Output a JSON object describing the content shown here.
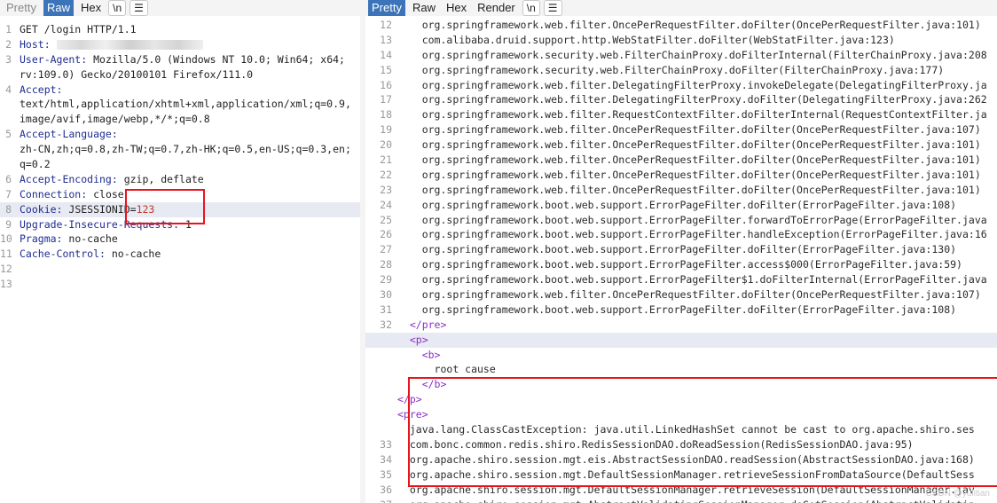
{
  "request_panel": {
    "tabs": [
      {
        "label": "Pretty",
        "state": "inactive"
      },
      {
        "label": "Raw",
        "state": "active"
      },
      {
        "label": "Hex",
        "state": "normal"
      }
    ],
    "newline_button": "\\n",
    "menu_icon": "hamburger-menu-icon",
    "lines": [
      {
        "num": "1",
        "value": "GET /login HTTP/1.1"
      },
      {
        "num": "2",
        "header": "Host:",
        "value": "",
        "blurred": true
      },
      {
        "num": "3",
        "header": "User-Agent:",
        "value": " Mozilla/5.0 (Windows NT 10.0; Win64; x64;"
      },
      {
        "num": "",
        "value": "rv:109.0) Gecko/20100101 Firefox/111.0"
      },
      {
        "num": "4",
        "header": "Accept:",
        "value": ""
      },
      {
        "num": "",
        "value": "text/html,application/xhtml+xml,application/xml;q=0.9,"
      },
      {
        "num": "",
        "value": "image/avif,image/webp,*/*;q=0.8"
      },
      {
        "num": "5",
        "header": "Accept-Language:",
        "value": ""
      },
      {
        "num": "",
        "value": "zh-CN,zh;q=0.8,zh-TW;q=0.7,zh-HK;q=0.5,en-US;q=0.3,en;"
      },
      {
        "num": "",
        "value": "q=0.2"
      },
      {
        "num": "6",
        "header": "Accept-Encoding:",
        "value": " gzip, deflate"
      },
      {
        "num": "7",
        "header": "Connection:",
        "value": " close"
      },
      {
        "num": "8",
        "header": "Cookie:",
        "value": " JSESSIONID=",
        "cookie_value": "123",
        "highlight": true
      },
      {
        "num": "9",
        "header": "Upgrade-Insecure-Requests:",
        "value": " 1"
      },
      {
        "num": "10",
        "header": "Pragma:",
        "value": " no-cache"
      },
      {
        "num": "11",
        "header": "Cache-Control:",
        "value": " no-cache"
      },
      {
        "num": "12",
        "value": ""
      },
      {
        "num": "13",
        "value": ""
      }
    ]
  },
  "response_panel": {
    "tabs": [
      {
        "label": "Pretty",
        "state": "active"
      },
      {
        "label": "Raw",
        "state": "normal"
      },
      {
        "label": "Hex",
        "state": "normal"
      },
      {
        "label": "Render",
        "state": "normal"
      }
    ],
    "newline_button": "\\n",
    "menu_icon": "hamburger-menu-icon",
    "lines": [
      {
        "num": "12",
        "indent": "    ",
        "text": "org.springframework.web.filter.OncePerRequestFilter.doFilter(OncePerRequestFilter.java:101)"
      },
      {
        "num": "13",
        "indent": "    ",
        "text": "com.alibaba.druid.support.http.WebStatFilter.doFilter(WebStatFilter.java:123)"
      },
      {
        "num": "14",
        "indent": "    ",
        "text": "org.springframework.security.web.FilterChainProxy.doFilterInternal(FilterChainProxy.java:208"
      },
      {
        "num": "15",
        "indent": "    ",
        "text": "org.springframework.security.web.FilterChainProxy.doFilter(FilterChainProxy.java:177)"
      },
      {
        "num": "16",
        "indent": "    ",
        "text": "org.springframework.web.filter.DelegatingFilterProxy.invokeDelegate(DelegatingFilterProxy.ja"
      },
      {
        "num": "17",
        "indent": "    ",
        "text": "org.springframework.web.filter.DelegatingFilterProxy.doFilter(DelegatingFilterProxy.java:262"
      },
      {
        "num": "18",
        "indent": "    ",
        "text": "org.springframework.web.filter.RequestContextFilter.doFilterInternal(RequestContextFilter.ja"
      },
      {
        "num": "19",
        "indent": "    ",
        "text": "org.springframework.web.filter.OncePerRequestFilter.doFilter(OncePerRequestFilter.java:107)"
      },
      {
        "num": "20",
        "indent": "    ",
        "text": "org.springframework.web.filter.OncePerRequestFilter.doFilter(OncePerRequestFilter.java:101)"
      },
      {
        "num": "21",
        "indent": "    ",
        "text": "org.springframework.web.filter.OncePerRequestFilter.doFilter(OncePerRequestFilter.java:101)"
      },
      {
        "num": "22",
        "indent": "    ",
        "text": "org.springframework.web.filter.OncePerRequestFilter.doFilter(OncePerRequestFilter.java:101)"
      },
      {
        "num": "23",
        "indent": "    ",
        "text": "org.springframework.web.filter.OncePerRequestFilter.doFilter(OncePerRequestFilter.java:101)"
      },
      {
        "num": "24",
        "indent": "    ",
        "text": "org.springframework.boot.web.support.ErrorPageFilter.doFilter(ErrorPageFilter.java:108)"
      },
      {
        "num": "25",
        "indent": "    ",
        "text": "org.springframework.boot.web.support.ErrorPageFilter.forwardToErrorPage(ErrorPageFilter.java"
      },
      {
        "num": "26",
        "indent": "    ",
        "text": "org.springframework.boot.web.support.ErrorPageFilter.handleException(ErrorPageFilter.java:16"
      },
      {
        "num": "27",
        "indent": "    ",
        "text": "org.springframework.boot.web.support.ErrorPageFilter.doFilter(ErrorPageFilter.java:130)"
      },
      {
        "num": "28",
        "indent": "    ",
        "text": "org.springframework.boot.web.support.ErrorPageFilter.access$000(ErrorPageFilter.java:59)"
      },
      {
        "num": "29",
        "indent": "    ",
        "text": "org.springframework.boot.web.support.ErrorPageFilter$1.doFilterInternal(ErrorPageFilter.java"
      },
      {
        "num": "30",
        "indent": "    ",
        "text": "org.springframework.web.filter.OncePerRequestFilter.doFilter(OncePerRequestFilter.java:107)"
      },
      {
        "num": "31",
        "indent": "    ",
        "text": "org.springframework.boot.web.support.ErrorPageFilter.doFilter(ErrorPageFilter.java:108)"
      },
      {
        "num": "32",
        "indent": "  ",
        "tag": "</pre>"
      },
      {
        "num": "",
        "indent": "  ",
        "tag": "<p>",
        "highlight": true
      },
      {
        "num": "",
        "indent": "    ",
        "tag": "<b>"
      },
      {
        "num": "",
        "indent": "      ",
        "text": "root cause"
      },
      {
        "num": "",
        "indent": "    ",
        "tag": "</b>"
      },
      {
        "num": "",
        "indent": "",
        "tag": "</p>"
      },
      {
        "num": "",
        "indent": "",
        "tag": "<pre>"
      },
      {
        "num": "",
        "indent": "  ",
        "text": "java.lang.ClassCastException: java.util.LinkedHashSet cannot be cast to org.apache.shiro.ses"
      },
      {
        "num": "33",
        "indent": "  ",
        "text": "com.bonc.common.redis.shiro.RedisSessionDAO.doReadSession(RedisSessionDAO.java:95)"
      },
      {
        "num": "34",
        "indent": "  ",
        "text": "org.apache.shiro.session.mgt.eis.AbstractSessionDAO.readSession(AbstractSessionDAO.java:168)"
      },
      {
        "num": "35",
        "indent": "  ",
        "text": "org.apache.shiro.session.mgt.DefaultSessionManager.retrieveSessionFromDataSource(DefaultSess"
      },
      {
        "num": "36",
        "indent": "  ",
        "text": "org.apache.shiro.session.mgt.DefaultSessionManager.retrieveSession(DefaultSessionManager.jav"
      },
      {
        "num": "37",
        "indent": "  ",
        "text": "org.apache.shiro.session.mgt.AbstractValidatingSessionManager.doGetSession(AbstractValidatin"
      }
    ]
  },
  "watermark": "CSDN @yulitian",
  "colors": {
    "accent": "#3b74b8",
    "annotation": "#e8141c",
    "header_key": "#1f2d8f",
    "cookie_value": "#c0392b",
    "tag": "#8a2ec9"
  }
}
